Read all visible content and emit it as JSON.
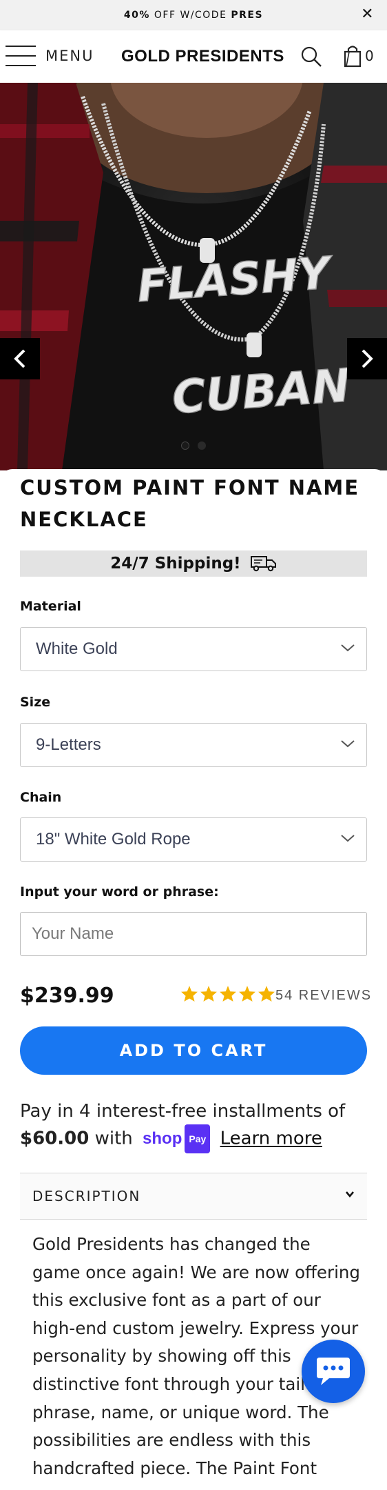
{
  "announcement": {
    "bold_prefix": "40%",
    "middle": " OFF W/CODE ",
    "code": "PRES",
    "close_glyph": "✕"
  },
  "header": {
    "menu_label": "MENU",
    "brand": "GOLD PRESIDENTS",
    "cart_count": "0",
    "icons": [
      "hamburger-icon",
      "search-icon",
      "cart-bag-icon"
    ]
  },
  "gallery": {
    "pendant_text_1": "FLASHY",
    "pendant_text_2": "CUBAN",
    "slide_count": 2,
    "active_slide": 1
  },
  "product": {
    "title": "CUSTOM PAINT FONT NAME NECKLACE",
    "shipping_banner": "24/7 Shipping!",
    "options": [
      {
        "label": "Material",
        "value": "White Gold"
      },
      {
        "label": "Size",
        "value": "9-Letters"
      },
      {
        "label": "Chain",
        "value": "18\" White Gold Rope"
      }
    ],
    "custom_text": {
      "label": "Input your word or phrase:",
      "placeholder": "Your Name",
      "value": ""
    },
    "price": "$239.99",
    "rating_stars": 5,
    "reviews": "54 REVIEWS",
    "add_to_cart": "ADD TO CART"
  },
  "installments": {
    "line1": "Pay in 4 interest-free installments of",
    "amount": "$60.00",
    "with": " with ",
    "shop_word": "shop",
    "pay_badge": "Pay",
    "learn_more": "Learn more"
  },
  "description": {
    "tab_label": "DESCRIPTION",
    "text": "Gold Presidents has changed the game once again! We are now offering this exclusive font as a part of our high-end custom jewelry. Express your personality by showing off this distinctive font through your tailored phrase, name, or unique word. The possibilities are endless with this handcrafted piece. The Paint Font"
  },
  "colors": {
    "primary_button": "#1877f2",
    "chat_button": "#1460e6",
    "star": "#f5b301",
    "shop_pay": "#5a31f4"
  }
}
